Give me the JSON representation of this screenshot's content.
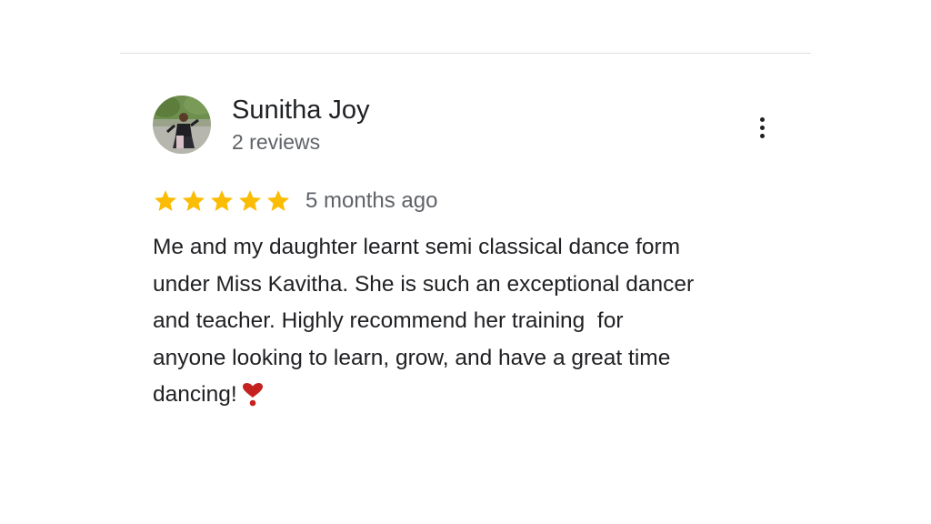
{
  "review": {
    "reviewer_name": "Sunitha Joy",
    "review_count": "2 reviews",
    "rating": 5,
    "rating_max": 5,
    "date": "5 months ago",
    "text": "Me and my daughter learnt semi classical dance form\nunder Miss Kavitha. She is such an exceptional dancer\nand teacher. Highly recommend her training  for\nanyone looking to learn, grow, and have a great time\ndancing!",
    "emoji": "heart-exclamation-icon"
  },
  "icons": {
    "more": "more-vert-icon",
    "star": "star-icon",
    "avatar": "avatar-photo"
  },
  "colors": {
    "star": "#fbbc04",
    "text_primary": "#202124",
    "text_secondary": "#5f6368",
    "divider": "#dadce0",
    "heart": "#c5221f"
  }
}
